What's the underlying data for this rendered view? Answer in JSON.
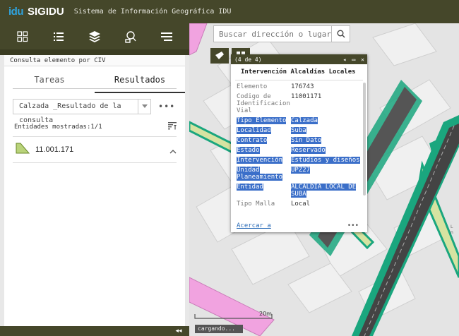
{
  "header": {
    "logo_text": "idu",
    "app_name": "SIGIDU",
    "subtitle": "Sistema de Información Geográfica IDU"
  },
  "toolbar": {
    "icons": [
      "widgets-icon",
      "list-icon",
      "layers-icon",
      "identify-icon",
      "menu-icon"
    ]
  },
  "panel": {
    "title": "Consulta elemento por CIV",
    "tabs": [
      "Tareas",
      "Resultados"
    ],
    "active_tab": "Resultados",
    "select_value": "Calzada _Resultado de la consulta",
    "more_label": "•••",
    "count_label": "Entidades mostradas:1/1",
    "result_item": "11.001.171",
    "collapse_label": "◂◂"
  },
  "search": {
    "placeholder": "Buscar dirección o lugar"
  },
  "popup": {
    "counter": "(4 de 4)",
    "prev": "◂",
    "maximize": "▭",
    "close": "✕",
    "title": "Intervención Alcaldías Locales",
    "attrs": [
      {
        "k": "Elemento",
        "v": "176743",
        "hl": false
      },
      {
        "k": "Codigo de Identificacion Vial",
        "v": "11001171",
        "hl": false
      },
      {
        "k": "Tipo Elemento",
        "v": "Calzada",
        "hl": true
      },
      {
        "k": "Localidad",
        "v": "Suba",
        "hl": true
      },
      {
        "k": "Contrato",
        "v": "Sin Dato",
        "hl": true
      },
      {
        "k": "Estado",
        "v": "Reservado",
        "hl": true
      },
      {
        "k": "Intervención",
        "v": "Estudios y diseños",
        "hl": true
      },
      {
        "k": "Unidad Planeamiento",
        "v": "UPZ27",
        "hl": true
      },
      {
        "k": "Entidad",
        "v": "ALCALDIA LOCAL DE SUBA",
        "hl": true
      },
      {
        "k": "Tipo Malla",
        "v": "Local",
        "hl": false
      }
    ],
    "zoom_link": "Acercar a",
    "more": "•••"
  },
  "map": {
    "scale_label": "20m",
    "loading": "cargando..."
  },
  "colors": {
    "header_bg": "#45472a",
    "accent_green": "#1aa67e",
    "road_yellow": "#d6e3a1",
    "highlight_blue": "#3b6fc9",
    "pink_road": "#f1a3e0"
  }
}
